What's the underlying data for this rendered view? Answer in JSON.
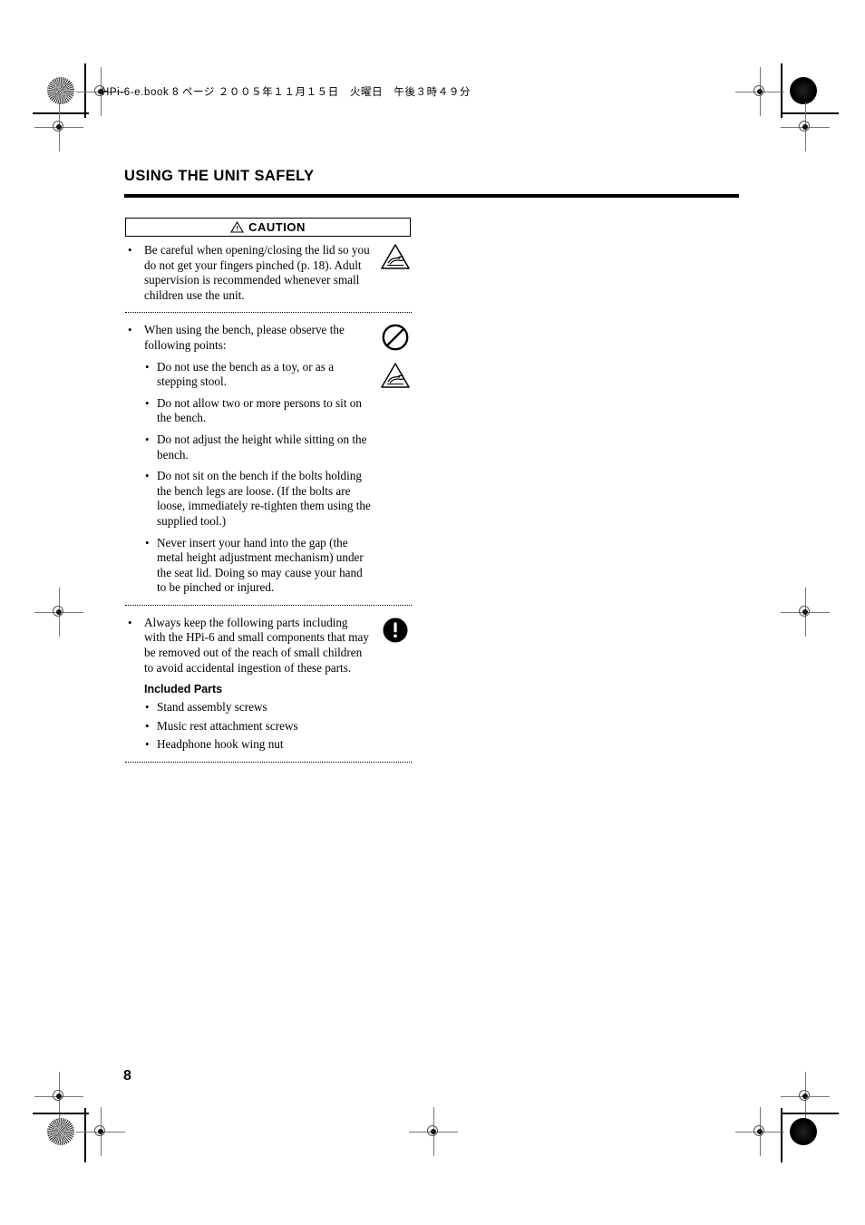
{
  "document": {
    "file_header": "HPi-6-e.book  8 ページ  ２００５年１１月１５日　火曜日　午後３時４９分",
    "page_title": "USING THE UNIT SAFELY",
    "page_number": "8"
  },
  "caution": {
    "label": "CAUTION",
    "icon": "warning-triangle-icon"
  },
  "sections": [
    {
      "id": "lid-pinch",
      "bullet": "•",
      "text": "Be careful when opening/closing the lid so you do not get your fingers pinched (p. 18). Adult supervision is recommended whenever small children use the unit.",
      "icons": [
        "pinch-warning-triangle-icon"
      ]
    },
    {
      "id": "bench-usage",
      "bullet": "•",
      "text": "When using the bench, please observe the following points:",
      "icons": [
        "prohibition-circle-icon",
        "pinch-warning-triangle-icon"
      ],
      "subitems": [
        "Do not use the bench as a toy, or as a stepping stool.",
        "Do not allow two or more persons to sit on the bench.",
        "Do not adjust the height while sitting on the bench.",
        "Do not sit on the bench if the bolts holding the bench legs are loose. (If the bolts are loose, immediately re-tighten them using the supplied tool.)",
        "Never insert your hand into the gap (the metal height adjustment mechanism) under the seat lid. Doing so may cause your hand to be pinched or injured."
      ]
    },
    {
      "id": "small-parts",
      "bullet": "•",
      "text": "Always keep the following parts including with the HPi-6 and small components that may be removed out of the reach of small children to avoid accidental ingestion of these parts.",
      "icons": [
        "exclamation-circle-icon"
      ],
      "included_parts_heading": "Included Parts",
      "included_parts": [
        "Stand assembly screws",
        "Music rest attachment screws",
        "Headphone hook wing nut"
      ]
    }
  ],
  "sub_bullet": "•",
  "colors": {
    "text": "#000000",
    "rule": "#000000",
    "background": "#ffffff",
    "registration": "#777777"
  }
}
